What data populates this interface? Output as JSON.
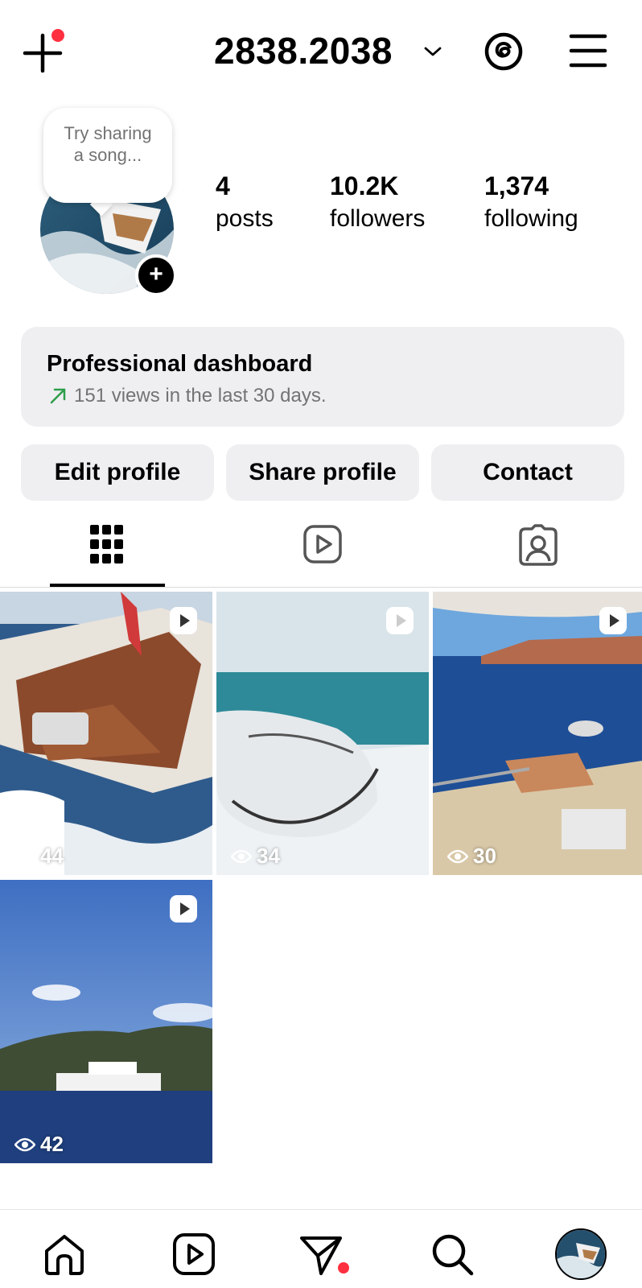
{
  "header": {
    "username": "2838.2038",
    "icons": [
      "add-icon",
      "chevron-down-icon",
      "threads-icon",
      "menu-icon"
    ],
    "notification_color": "#ff3040"
  },
  "profile": {
    "note_bubble": "Try sharing a song...",
    "stats": [
      {
        "value": "4",
        "label": "posts"
      },
      {
        "value": "10.2K",
        "label": "followers"
      },
      {
        "value": "1,374",
        "label": "following"
      }
    ]
  },
  "dashboard": {
    "title": "Professional dashboard",
    "subtitle": "151 views in the last 30 days.",
    "accent_color": "#2e9e4a"
  },
  "buttons": {
    "edit": "Edit profile",
    "share": "Share profile",
    "contact": "Contact"
  },
  "tabs": [
    "grid-icon",
    "reels-icon",
    "tagged-icon"
  ],
  "posts": [
    {
      "views": "44",
      "type": "reel"
    },
    {
      "views": "34",
      "type": "reel"
    },
    {
      "views": "30",
      "type": "reel"
    },
    {
      "views": "42",
      "type": "reel"
    }
  ],
  "bottom_nav": [
    "home-icon",
    "reels-icon",
    "messages-icon",
    "search-icon",
    "profile-avatar"
  ]
}
